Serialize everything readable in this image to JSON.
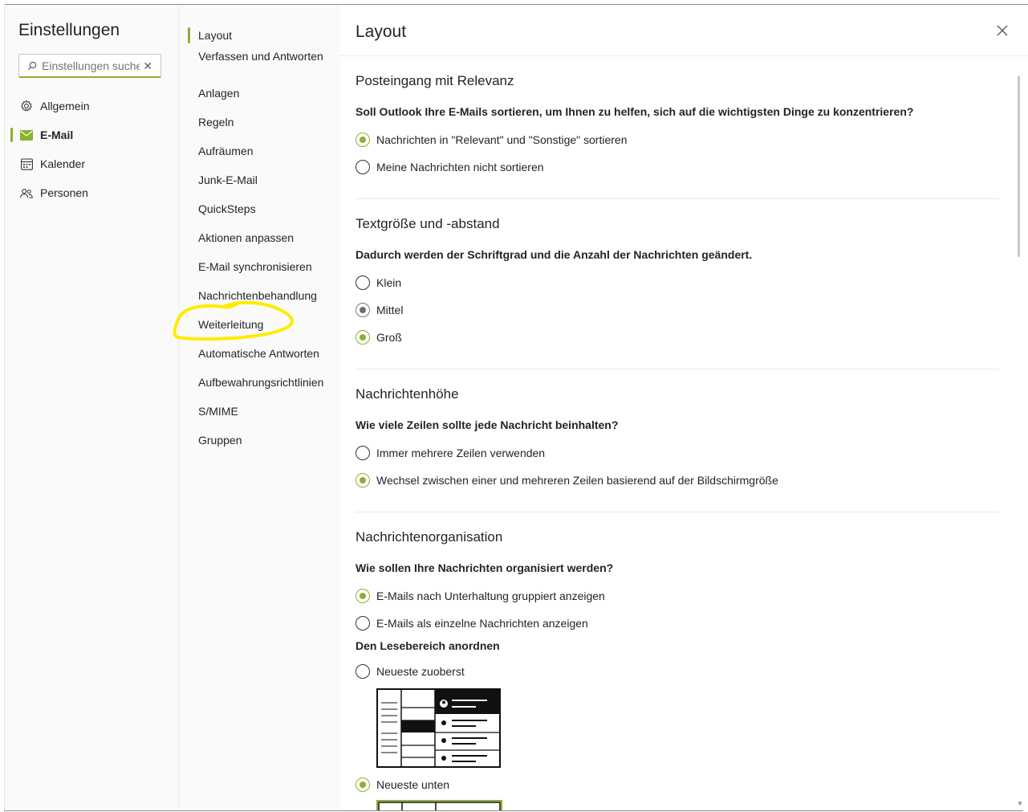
{
  "sidebar": {
    "title": "Einstellungen",
    "search_placeholder": "Einstellungen suchen",
    "items": [
      {
        "label": "Allgemein",
        "icon": "gear-icon"
      },
      {
        "label": "E-Mail",
        "icon": "mail-icon",
        "active": true
      },
      {
        "label": "Kalender",
        "icon": "calendar-icon"
      },
      {
        "label": "Personen",
        "icon": "people-icon"
      }
    ]
  },
  "subnav": {
    "items": [
      {
        "label": "Layout",
        "active": true
      },
      {
        "label": "Verfassen und Antworten"
      },
      {
        "label": "Anlagen"
      },
      {
        "label": "Regeln"
      },
      {
        "label": "Aufräumen"
      },
      {
        "label": "Junk-E-Mail"
      },
      {
        "label": "QuickSteps"
      },
      {
        "label": "Aktionen anpassen"
      },
      {
        "label": "E-Mail synchronisieren"
      },
      {
        "label": "Nachrichtenbehandlung"
      },
      {
        "label": "Weiterleitung",
        "annotated": true
      },
      {
        "label": "Automatische Antworten"
      },
      {
        "label": "Aufbewahrungsrichtlinien"
      },
      {
        "label": "S/MIME"
      },
      {
        "label": "Gruppen"
      }
    ],
    "annotation_color": "#ffeb00"
  },
  "main": {
    "title": "Layout",
    "close_icon": "close-icon",
    "sections": [
      {
        "heading": "Posteingang mit Relevanz",
        "question": "Soll Outlook Ihre E-Mails sortieren, um Ihnen zu helfen, sich auf die wichtigsten Dinge zu konzentrieren?",
        "options": [
          {
            "label": "Nachrichten in \"Relevant\" und \"Sonstige\" sortieren",
            "selected": true
          },
          {
            "label": "Meine Nachrichten nicht sortieren",
            "selected": false
          }
        ]
      },
      {
        "heading": "Textgröße und -abstand",
        "question": "Dadurch werden der Schriftgrad und die Anzahl der Nachrichten geändert.",
        "options": [
          {
            "label": "Klein",
            "selected": false
          },
          {
            "label": "Mittel",
            "selected": false,
            "state": "hover"
          },
          {
            "label": "Groß",
            "selected": true
          }
        ]
      },
      {
        "heading": "Nachrichtenhöhe",
        "question": "Wie viele Zeilen sollte jede Nachricht beinhalten?",
        "options": [
          {
            "label": "Immer mehrere Zeilen verwenden",
            "selected": false
          },
          {
            "label": "Wechsel zwischen einer und mehreren Zeilen basierend auf der Bildschirmgröße",
            "selected": true
          }
        ]
      },
      {
        "heading": "Nachrichtenorganisation",
        "question": "Wie sollen Ihre Nachrichten organisiert werden?",
        "options": [
          {
            "label": "E-Mails nach Unterhaltung gruppiert anzeigen",
            "selected": true
          },
          {
            "label": "E-Mails als einzelne Nachrichten anzeigen",
            "selected": false
          }
        ],
        "subheading": "Den Lesebereich anordnen",
        "order_options": [
          {
            "label": "Neueste zuoberst",
            "selected": false
          },
          {
            "label": "Neueste unten",
            "selected": true
          }
        ]
      }
    ]
  },
  "colors": {
    "accent": "#8cb032",
    "panel_bg": "#fafafa",
    "text": "#242424"
  }
}
